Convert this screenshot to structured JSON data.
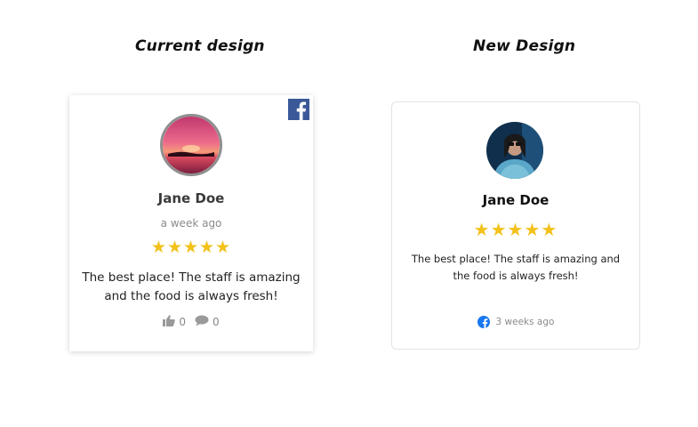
{
  "headings": {
    "current": "Current design",
    "new": "New Design"
  },
  "current_card": {
    "name": "Jane Doe",
    "time": "a week ago",
    "stars": "★★★★★",
    "rating": 5,
    "review": "The best place! The staff is amazing and the food is always fresh!",
    "likes": "0",
    "comments": "0",
    "icons": [
      "facebook-icon",
      "thumbs-up-icon",
      "comment-icon"
    ]
  },
  "new_card": {
    "name": "Jane Doe",
    "stars": "★★★★★",
    "rating": 5,
    "review": "The best place! The staff is amazing and the food is always fresh!",
    "time": "3 weeks ago",
    "icons": [
      "facebook-icon"
    ]
  },
  "colors": {
    "star": "#f3c11b",
    "facebook_square": "#3b5998",
    "facebook_circle": "#1877f2"
  }
}
